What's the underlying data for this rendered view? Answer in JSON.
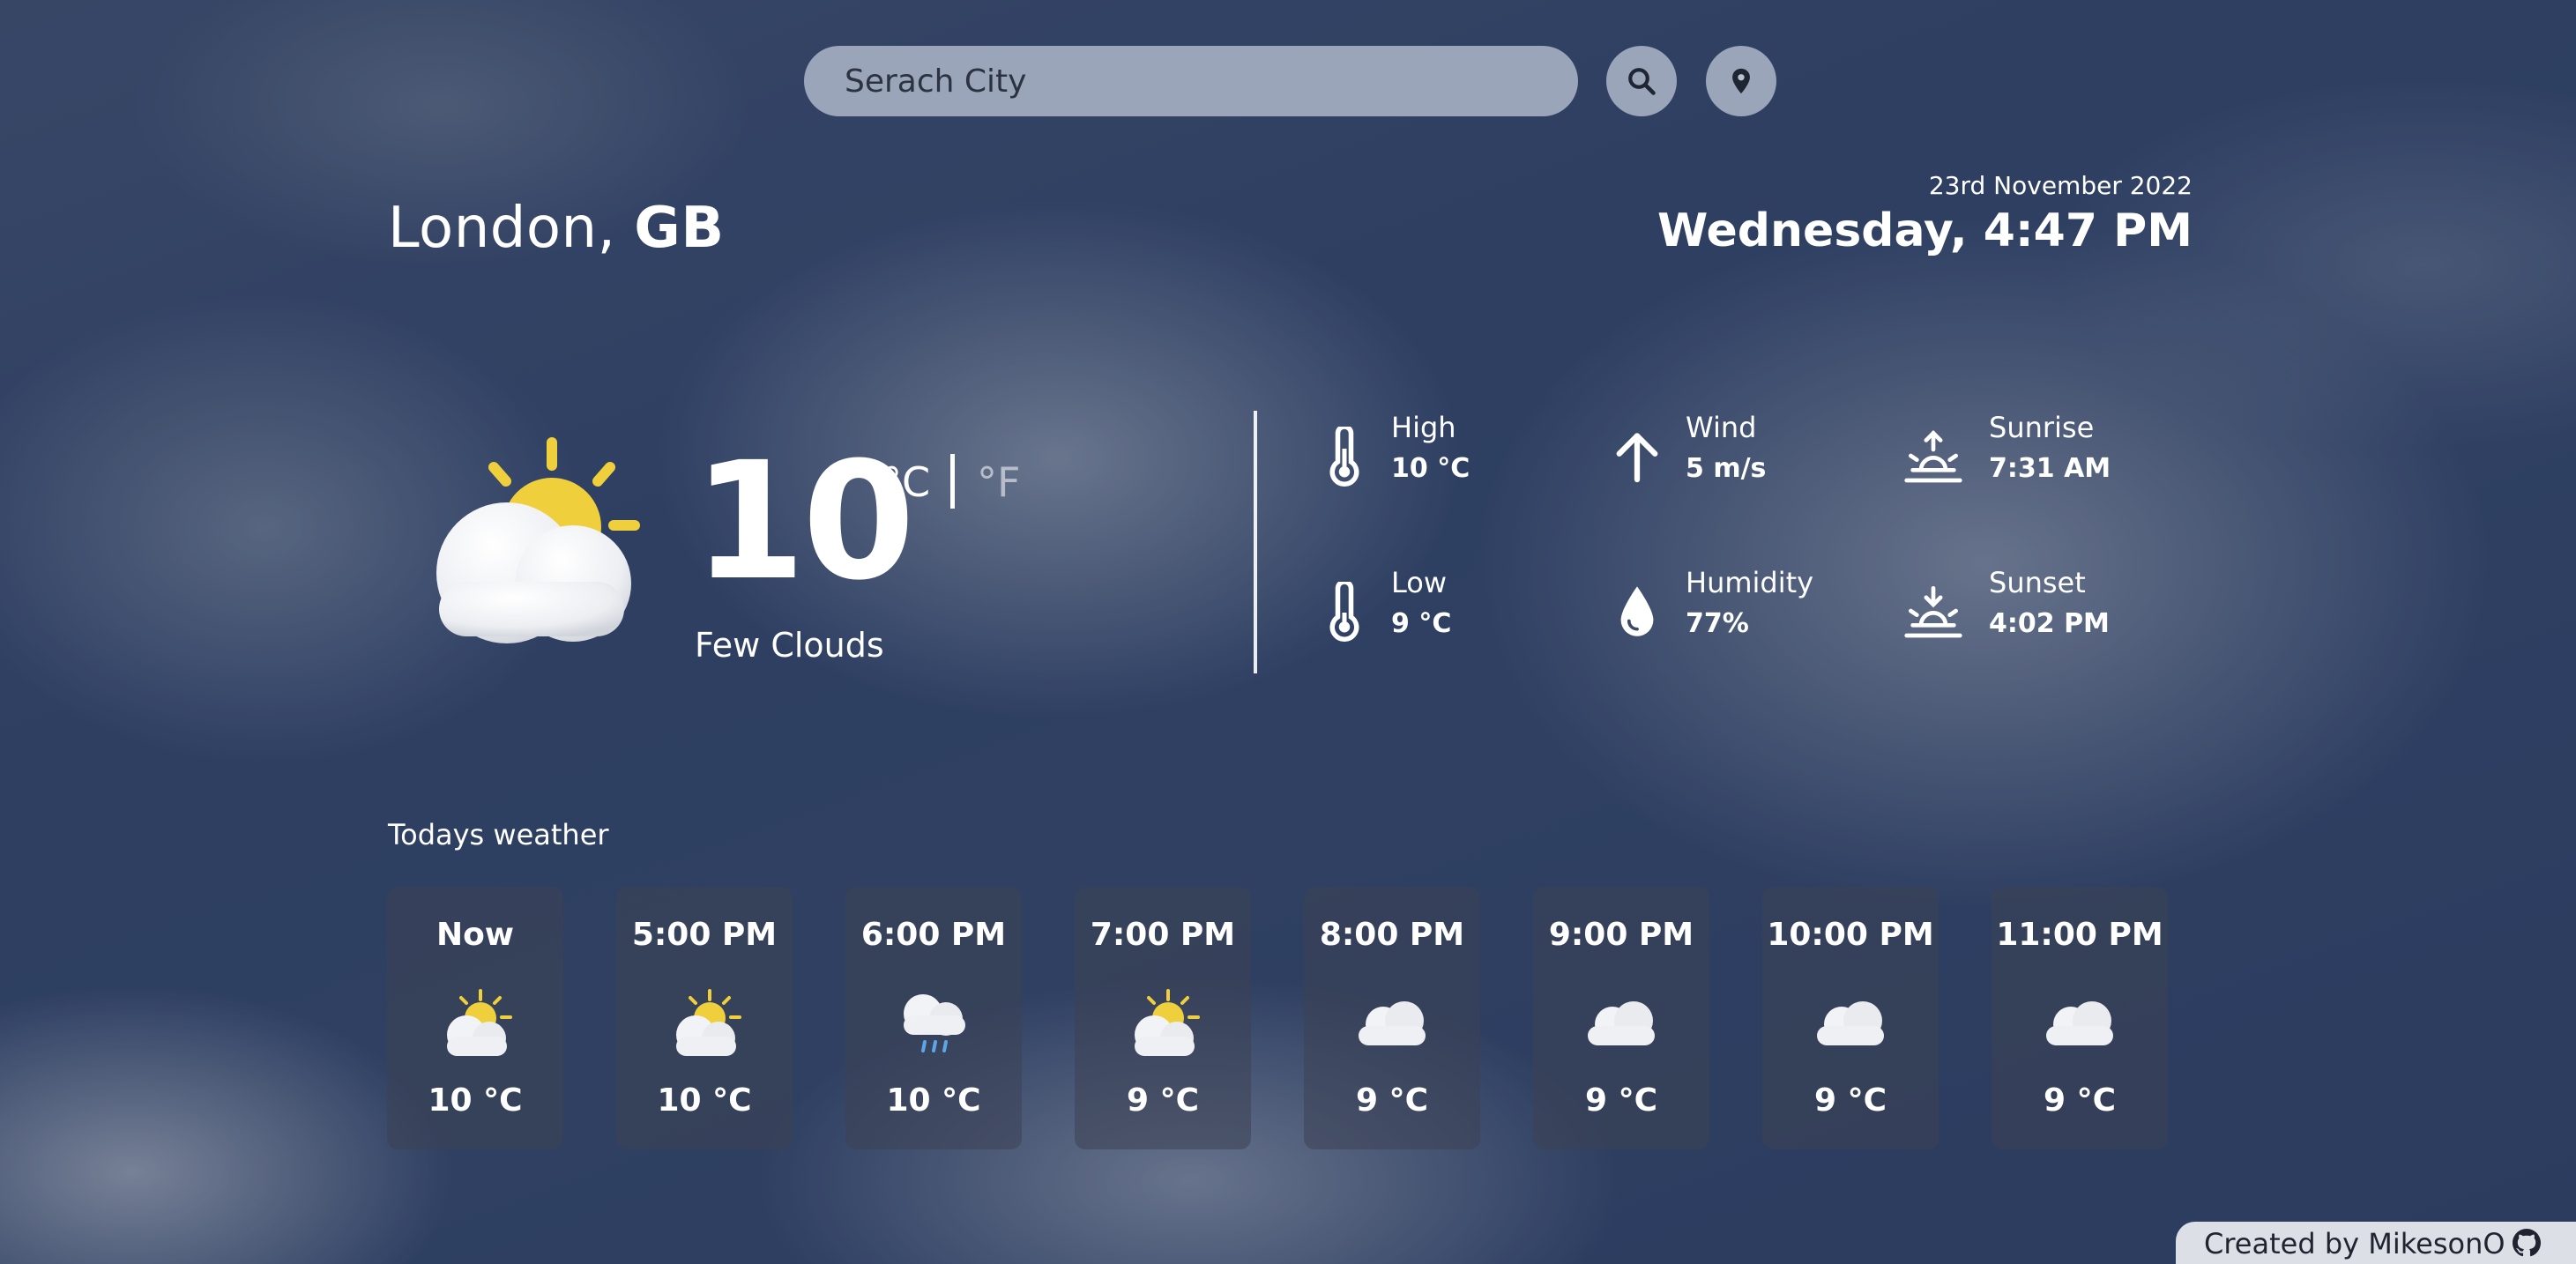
{
  "search": {
    "placeholder": "Serach City",
    "search_icon": "search-icon",
    "location_icon": "location-pin-icon"
  },
  "location": {
    "city": "London,",
    "country": "GB"
  },
  "datetime": {
    "date": "23rd November 2022",
    "day_time": "Wednesday, 4:47 PM"
  },
  "current": {
    "icon": "partly-cloudy-sun-icon",
    "temperature": "10",
    "unit_celsius": "°C",
    "unit_fahrenheit": "°F",
    "active_unit": "celsius",
    "description": "Few Clouds"
  },
  "stats": [
    {
      "icon": "thermometer-icon",
      "label": "High",
      "value": "10 °C"
    },
    {
      "icon": "arrow-up-icon",
      "label": "Wind",
      "value": "5 m/s"
    },
    {
      "icon": "sunrise-icon",
      "label": "Sunrise",
      "value": "7:31 AM"
    },
    {
      "icon": "thermometer-icon",
      "label": "Low",
      "value": "9 °C"
    },
    {
      "icon": "droplet-icon",
      "label": "Humidity",
      "value": "77%"
    },
    {
      "icon": "sunset-icon",
      "label": "Sunset",
      "value": "4:02 PM"
    }
  ],
  "today": {
    "title": "Todays weather",
    "hours": [
      {
        "time": "Now",
        "icon": "partly-cloudy-sun-icon",
        "temp": "10 °C"
      },
      {
        "time": "5:00 PM",
        "icon": "partly-cloudy-sun-icon",
        "temp": "10 °C"
      },
      {
        "time": "6:00 PM",
        "icon": "rain-cloud-icon",
        "temp": "10 °C"
      },
      {
        "time": "7:00 PM",
        "icon": "partly-cloudy-sun-icon",
        "temp": "9 °C"
      },
      {
        "time": "8:00 PM",
        "icon": "cloud-icon",
        "temp": "9 °C"
      },
      {
        "time": "9:00 PM",
        "icon": "cloud-icon",
        "temp": "9 °C"
      },
      {
        "time": "10:00 PM",
        "icon": "cloud-icon",
        "temp": "9 °C"
      },
      {
        "time": "11:00 PM",
        "icon": "cloud-icon",
        "temp": "9 °C"
      }
    ]
  },
  "footer": {
    "credit": "Created by MikesonO",
    "icon": "github-icon"
  },
  "colors": {
    "sun": "#f0cf3c",
    "rain": "#5aa6e8",
    "card_bg": "#3c4254"
  }
}
